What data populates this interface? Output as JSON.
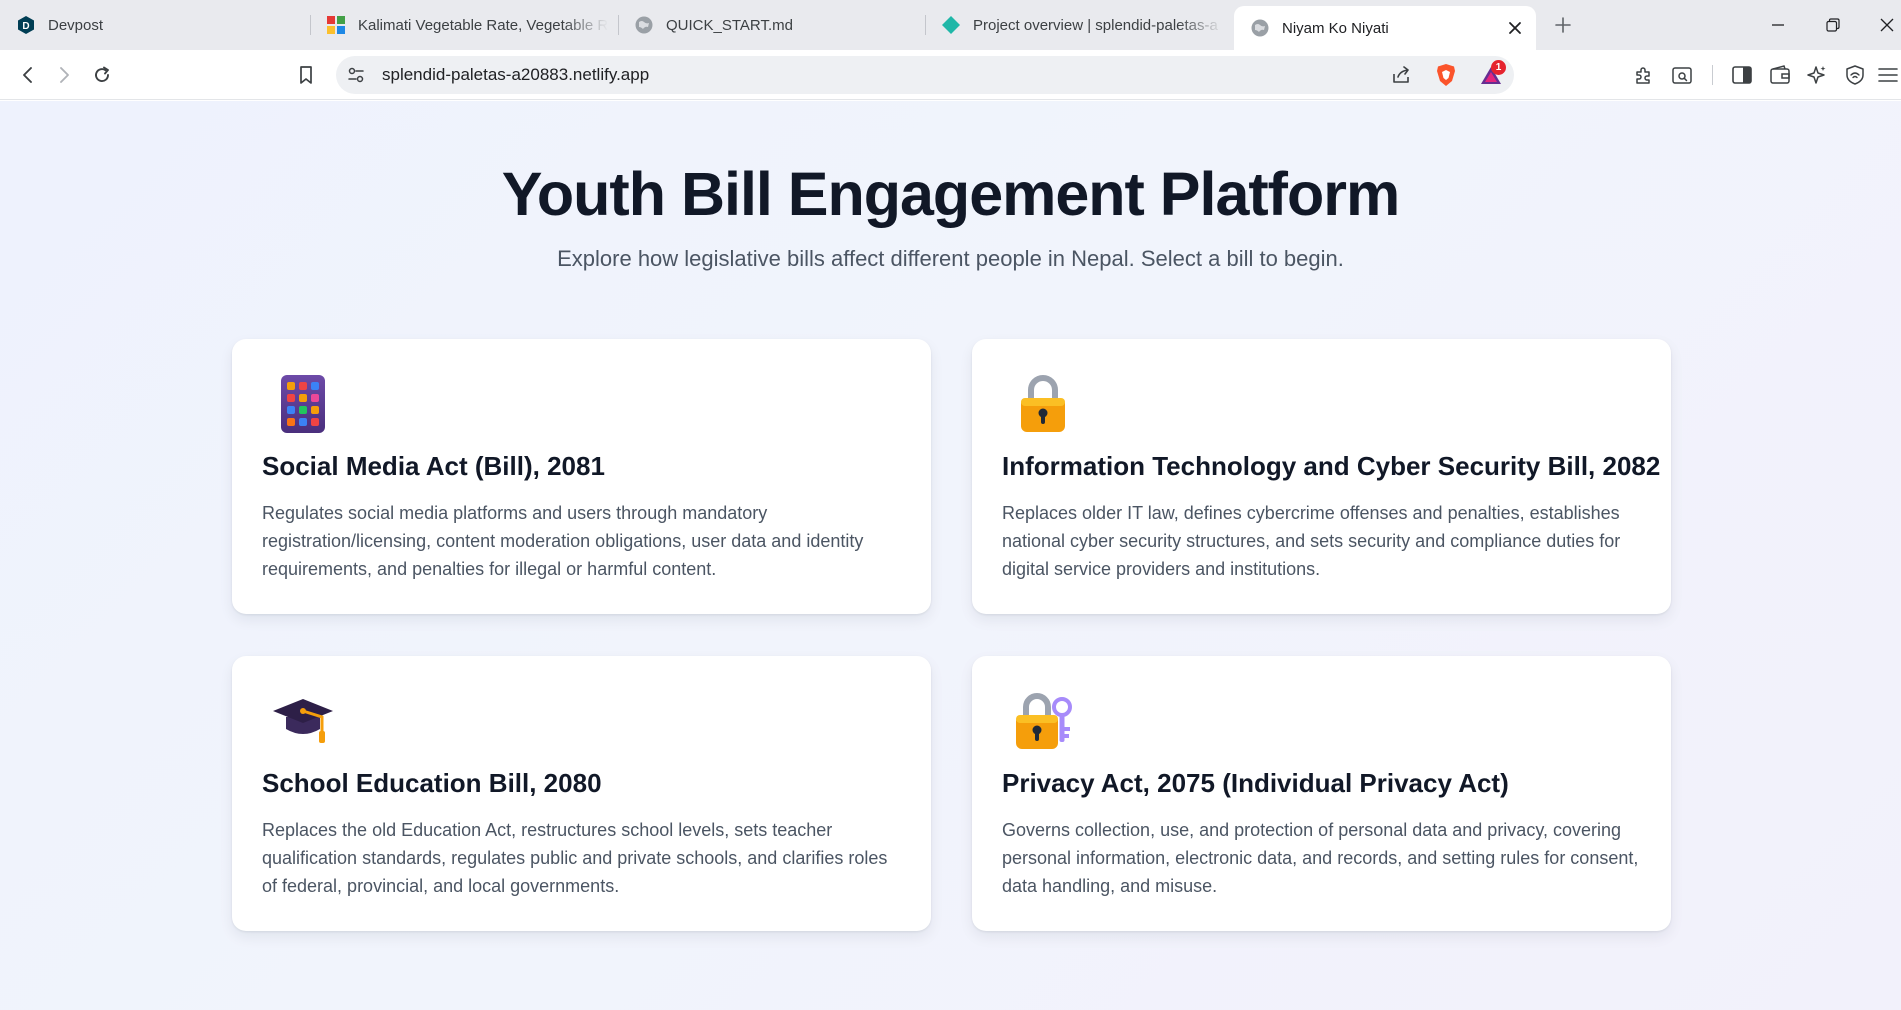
{
  "browser": {
    "tabs": [
      {
        "title": "Devpost",
        "icon": "devpost-icon"
      },
      {
        "title": "Kalimati Vegetable Rate, Vegetable R",
        "icon": "kalimati-icon"
      },
      {
        "title": "QUICK_START.md",
        "icon": "globe-icon"
      },
      {
        "title": "Project overview | splendid-paletas-a",
        "icon": "netlify-icon"
      },
      {
        "title": "Niyam Ko Niyati",
        "icon": "globe-icon",
        "active": true
      }
    ],
    "url": "splendid-paletas-a20883.netlify.app",
    "notification_count": "1"
  },
  "page": {
    "title": "Youth Bill Engagement Platform",
    "subtitle": "Explore how legislative bills affect different people in Nepal. Select a bill to begin.",
    "bills": [
      {
        "icon": "mobile-phone-icon",
        "title": "Social Media Act (Bill), 2081",
        "description": "Regulates social media platforms and users through mandatory registration/licensing, content moderation obligations, user data and identity requirements, and penalties for illegal or harmful content."
      },
      {
        "icon": "padlock-icon",
        "title": "Information Technology and Cyber Security Bill, 2082",
        "description": "Replaces older IT law, defines cybercrime offenses and penalties, establishes national cyber security structures, and sets security and compliance duties for digital service providers and institutions."
      },
      {
        "icon": "graduation-cap-icon",
        "title": "School Education Bill, 2080",
        "description": "Replaces the old Education Act, restructures school levels, sets teacher qualification standards, regulates public and private schools, and clarifies roles of federal, provincial, and local governments."
      },
      {
        "icon": "locked-with-key-icon",
        "title": "Privacy Act, 2075 (Individual Privacy Act)",
        "description": "Governs collection, use, and protection of personal data and privacy, covering personal information, electronic data, and records, and setting rules for consent, data handling, and misuse."
      }
    ]
  },
  "colors": {
    "page_background": "#eef2fd",
    "title": "#111827",
    "text_muted": "#4b5563",
    "card_background": "#ffffff",
    "brave_orange": "#fb542b"
  }
}
